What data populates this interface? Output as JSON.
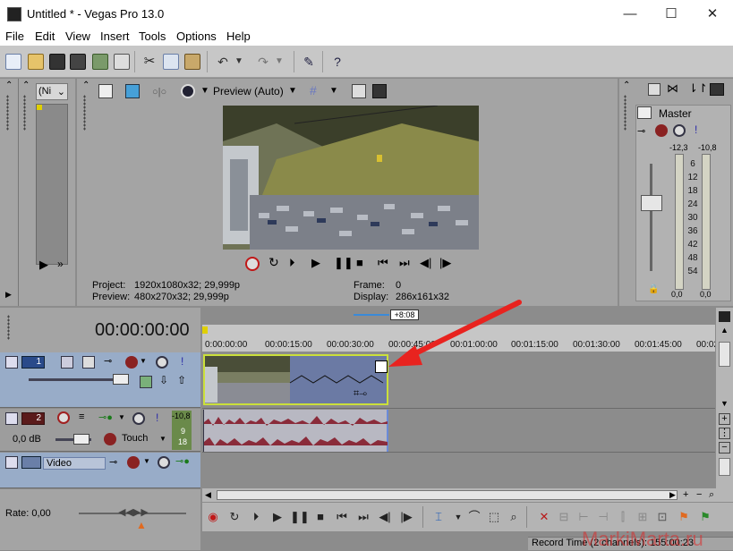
{
  "window": {
    "title": "Untitled * - Vegas Pro 13.0",
    "minimize": "—",
    "maximize": "☐",
    "close": "✕"
  },
  "menu": [
    "File",
    "Edit",
    "View",
    "Insert",
    "Tools",
    "Options",
    "Help"
  ],
  "preview": {
    "mode_label": "Preview (Auto)",
    "zoom_select": "(Ni",
    "project_label": "Project:",
    "project_value": "1920x1080x32; 29,999p",
    "preview_label": "Preview:",
    "preview_value": "480x270x32; 29,999p",
    "frame_label": "Frame:",
    "frame_value": "0",
    "display_label": "Display:",
    "display_value": "286x161x32"
  },
  "mixer": {
    "master_label": "Master",
    "left_peak": "-12,3",
    "right_peak": "-10,8",
    "scale": [
      "6",
      "12",
      "18",
      "24",
      "30",
      "36",
      "42",
      "48",
      "54"
    ],
    "left_value": "0,0",
    "right_value": "0,0"
  },
  "timeline": {
    "timecode": "00:00:00:00",
    "offset_badge": "+8:08",
    "ruler": [
      "0:00:00:00",
      "00:00:15:00",
      "00:00:30:00",
      "00:00:45:00",
      "00:01:00:00",
      "00:01:15:00",
      "00:01:30:00",
      "00:01:45:00",
      "00:02:0"
    ],
    "tracks": [
      {
        "number": "1",
        "type": "video"
      },
      {
        "number": "2",
        "type": "audio",
        "volume": "0,0 dB",
        "mode": "Touch",
        "meter_top": "-10,8",
        "meter_vals": [
          "9",
          "18"
        ]
      },
      {
        "number": "",
        "type": "video",
        "name": "Video"
      }
    ],
    "rate_label": "Rate: 0,00",
    "record_time": "Record Time (2 channels): 155:00:23"
  },
  "watermark": "MarkiMarta.ru",
  "colors": {
    "accent": "#cbe03a",
    "audio_wave": "#8a2b3a",
    "audio_bg": "#b8b8c2",
    "video_clip": "#6b7aa4",
    "arrow": "#e8231f"
  }
}
